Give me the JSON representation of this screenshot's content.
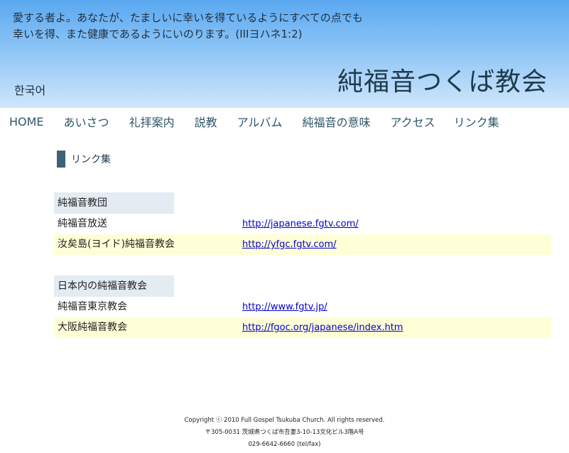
{
  "header": {
    "verse_line1": "愛する者よ。あなたが、たましいに幸いを得ているようにすべての点でも",
    "verse_line2": "幸いを得、また健康であるようにいのります。(IIIヨハネ1:2)",
    "language_link": "한국어",
    "site_title": "純福音つくば教会"
  },
  "nav": {
    "items": [
      "HOME",
      "あいさつ",
      "礼拝案内",
      "説教",
      "アルバム",
      "純福音の意味",
      "アクセス",
      "リンク集"
    ]
  },
  "section": {
    "heading": "リンク集"
  },
  "groups": [
    {
      "title": "純福音教団",
      "rows": [
        {
          "name": "純福音放送",
          "url": "http://japanese.fgtv.com/"
        },
        {
          "name": "汝矣島(ヨイド)純福音教会",
          "url": "http://yfgc.fgtv.com/"
        }
      ]
    },
    {
      "title": "日本内の純福音教会",
      "rows": [
        {
          "name": "純福音東京教会",
          "url": "http://www.fgtv.jp/"
        },
        {
          "name": "大阪純福音教会",
          "url": "http://fgoc.org/japanese/index.htm"
        }
      ]
    }
  ],
  "footer": {
    "copyright": "Copyright ⓒ 2010 Full Gospel Tsukuba Church. All rights reserved.",
    "address": "〒305-0031 茨城県つくば市吾妻3-10-13文化ビル3階A号",
    "phone": "029-6642-6660 (tel/fax)"
  },
  "colors": {
    "header_top": "#5aa8f0",
    "nav_text": "#2e5668",
    "group_title_bg": "#e3ebf3",
    "alt_row_bg": "#ffffd7",
    "link": "#0000cc"
  }
}
